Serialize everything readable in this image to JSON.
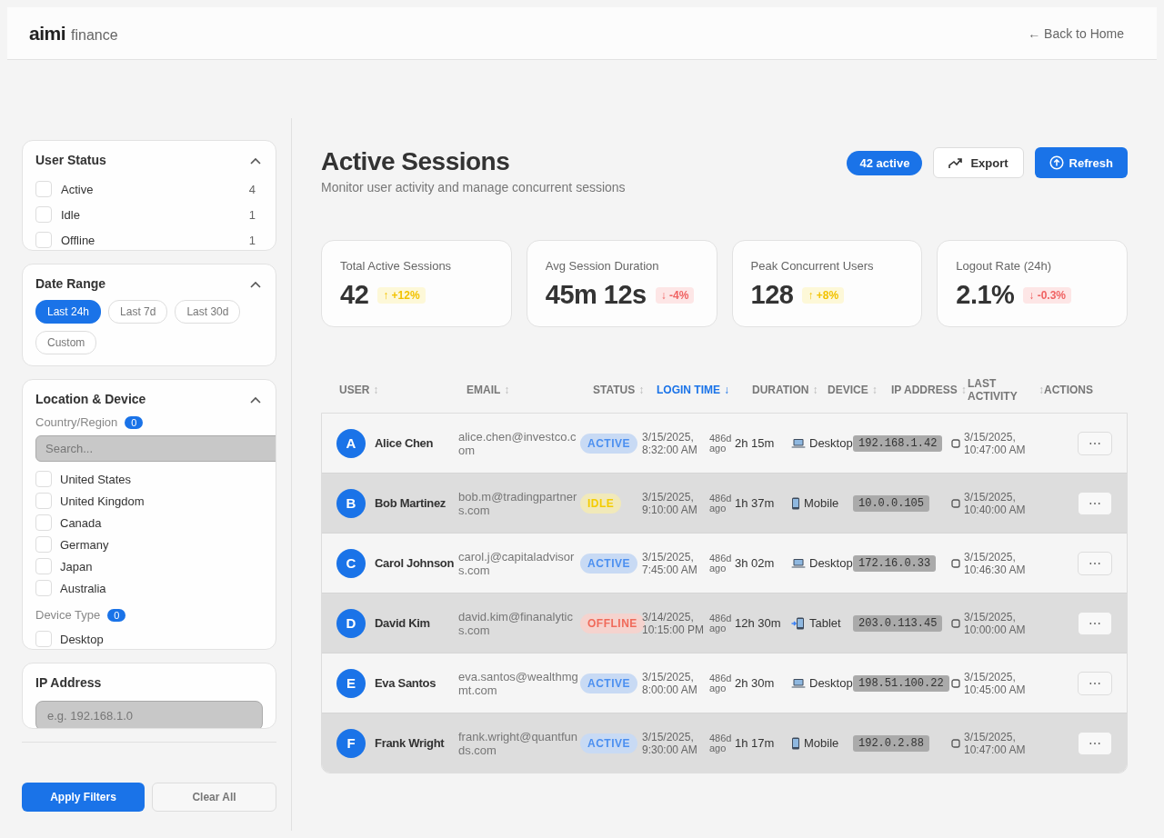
{
  "brand": {
    "name": "aimi",
    "suffix": "finance"
  },
  "back_link": "← Back to Home",
  "filters": {
    "user_status": {
      "title": "User Status",
      "expanded": true,
      "options": [
        {
          "label": "Active",
          "count": "4",
          "checked": false
        },
        {
          "label": "Idle",
          "count": "1",
          "checked": false
        },
        {
          "label": "Offline",
          "count": "1",
          "checked": false
        }
      ]
    },
    "date_range": {
      "title": "Date Range",
      "expanded": true,
      "options": [
        {
          "label": "Last 24h",
          "selected": true
        },
        {
          "label": "Last 7d",
          "selected": false
        },
        {
          "label": "Last 30d",
          "selected": false
        },
        {
          "label": "Custom",
          "selected": false
        }
      ]
    },
    "location_device": {
      "title": "Location & Device",
      "expanded": true,
      "country": {
        "label": "Country/Region",
        "count": "0",
        "search_placeholder": "Search...",
        "options": [
          {
            "label": "United States",
            "checked": false
          },
          {
            "label": "United Kingdom",
            "checked": false
          },
          {
            "label": "Canada",
            "checked": false
          },
          {
            "label": "Germany",
            "checked": false
          },
          {
            "label": "Japan",
            "checked": false
          },
          {
            "label": "Australia",
            "checked": false
          }
        ]
      },
      "device_type": {
        "label": "Device Type",
        "count": "0",
        "options": [
          {
            "label": "Desktop",
            "checked": false
          }
        ]
      }
    },
    "ip_address": {
      "title": "IP Address",
      "placeholder": "e.g. 192.168.1.0"
    }
  },
  "filter_actions": {
    "apply": "Apply Filters",
    "clear": "Clear All"
  },
  "page": {
    "title": "Active Sessions",
    "subtitle": "Monitor user activity and manage concurrent sessions",
    "active_badge": "42 active",
    "export": "Export",
    "refresh": "Refresh"
  },
  "stats": [
    {
      "label": "Total Active Sessions",
      "value": "42",
      "change": {
        "text": "↑ +12%",
        "kind": "up"
      }
    },
    {
      "label": "Avg Session Duration",
      "value": "45m 12s",
      "change": {
        "text": "↓ -4%",
        "kind": "down"
      }
    },
    {
      "label": "Peak Concurrent Users",
      "value": "128",
      "change": {
        "text": "↑ +8%",
        "kind": "up"
      }
    },
    {
      "label": "Logout Rate (24h)",
      "value": "2.1%",
      "change": {
        "text": "↓ -0.3%",
        "kind": "down"
      }
    }
  ],
  "table": {
    "columns": [
      {
        "label": "USER",
        "sort_icon": "↕",
        "selected": false
      },
      {
        "label": "EMAIL",
        "sort_icon": "↕",
        "selected": false
      },
      {
        "label": "STATUS",
        "sort_icon": "↕",
        "selected": false
      },
      {
        "label": "LOGIN TIME",
        "sort_icon": "↓",
        "selected": true
      },
      {
        "label": "DURATION",
        "sort_icon": "↕",
        "selected": false
      },
      {
        "label": "DEVICE",
        "sort_icon": "↕",
        "selected": false
      },
      {
        "label": "IP ADDRESS",
        "sort_icon": "↕",
        "selected": false
      },
      {
        "label": "LAST ACTIVITY",
        "sort_icon": "↕",
        "selected": false
      },
      {
        "label": "ACTIONS"
      }
    ],
    "rows": [
      {
        "avatar": "A",
        "name": "Alice Chen",
        "email": "alice.chen@investco.com",
        "status": {
          "label": "ACTIVE",
          "kind": "active"
        },
        "login_time": "3/15/2025, 8:32:00 AM",
        "ago": "486d ago",
        "duration": "2h 15m",
        "device": {
          "label": "Desktop",
          "kind": "laptop"
        },
        "ip": "192.168.1.42",
        "last_activity": "3/15/2025, 10:47:00 AM",
        "actions": "⋯"
      },
      {
        "avatar": "B",
        "name": "Bob Martinez",
        "email": "bob.m@tradingpartners.com",
        "status": {
          "label": "IDLE",
          "kind": "idle"
        },
        "login_time": "3/15/2025, 9:10:00 AM",
        "ago": "486d ago",
        "duration": "1h 37m",
        "device": {
          "label": "Mobile",
          "kind": "phone"
        },
        "ip": "10.0.0.105",
        "last_activity": "3/15/2025, 10:40:00 AM",
        "actions": "⋯"
      },
      {
        "avatar": "C",
        "name": "Carol Johnson",
        "email": "carol.j@capitaladvisors.com",
        "status": {
          "label": "ACTIVE",
          "kind": "active"
        },
        "login_time": "3/15/2025, 7:45:00 AM",
        "ago": "486d ago",
        "duration": "3h 02m",
        "device": {
          "label": "Desktop",
          "kind": "laptop"
        },
        "ip": "172.16.0.33",
        "last_activity": "3/15/2025, 10:46:30 AM",
        "actions": "⋯"
      },
      {
        "avatar": "D",
        "name": "David Kim",
        "email": "david.kim@finanalytics.com",
        "status": {
          "label": "OFFLINE",
          "kind": "offline"
        },
        "login_time": "3/14/2025, 10:15:00 PM",
        "ago": "486d ago",
        "duration": "12h 30m",
        "device": {
          "label": "Tablet",
          "kind": "tablet"
        },
        "ip": "203.0.113.45",
        "last_activity": "3/15/2025, 10:00:00 AM",
        "actions": "⋯"
      },
      {
        "avatar": "E",
        "name": "Eva Santos",
        "email": "eva.santos@wealthmgmt.com",
        "status": {
          "label": "ACTIVE",
          "kind": "active"
        },
        "login_time": "3/15/2025, 8:00:00 AM",
        "ago": "486d ago",
        "duration": "2h 30m",
        "device": {
          "label": "Desktop",
          "kind": "laptop"
        },
        "ip": "198.51.100.22",
        "last_activity": "3/15/2025, 10:45:00 AM",
        "actions": "⋯"
      },
      {
        "avatar": "F",
        "name": "Frank Wright",
        "email": "frank.wright@quantfunds.com",
        "status": {
          "label": "ACTIVE",
          "kind": "active"
        },
        "login_time": "3/15/2025, 9:30:00 AM",
        "ago": "486d ago",
        "duration": "1h 17m",
        "device": {
          "label": "Mobile",
          "kind": "phone"
        },
        "ip": "192.0.2.88",
        "last_activity": "3/15/2025, 10:47:00 AM",
        "actions": "⋯"
      }
    ]
  }
}
